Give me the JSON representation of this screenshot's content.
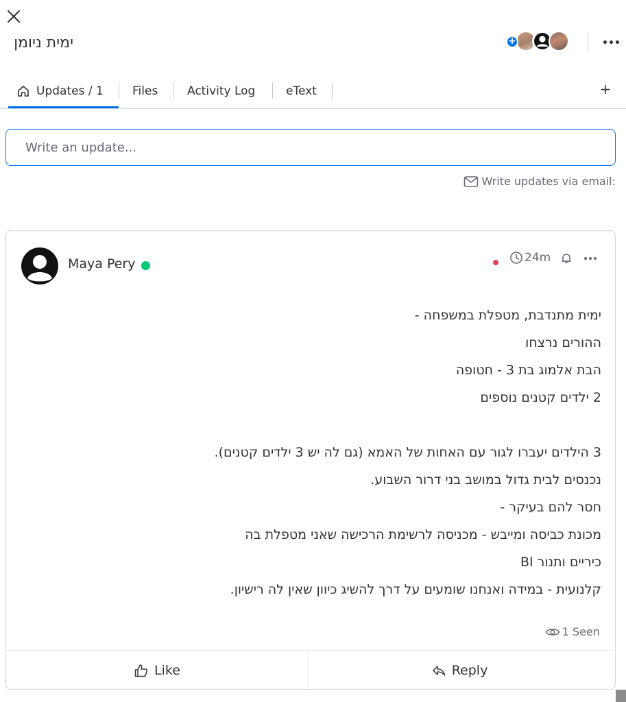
{
  "header": {
    "title": "ימית ניומן",
    "close_icon": "close-icon",
    "subscriber_add_label": "+",
    "more_icon": "more-horizontal-icon"
  },
  "tabs": {
    "items": [
      {
        "label": "Updates / 1",
        "icon": "home-icon",
        "active": true
      },
      {
        "label": "Files"
      },
      {
        "label": "Activity Log"
      },
      {
        "label": "eText"
      }
    ],
    "add_label": "+"
  },
  "composer": {
    "placeholder": "Write an update...",
    "email_link": "Write updates via email:"
  },
  "post": {
    "author": "Maya Pery",
    "time": "24m",
    "lines": [
      "ימית מתנדבת, מטפלת במשפחה -",
      "ההורים נרצחו",
      "הבת אלמוג בת 3 - חטופה",
      "2 ילדים קטנים נוספים",
      "",
      "3 הילדים יעברו לגור עם האחות של האמא (גם לה יש 3 ילדים קטנים).",
      "נכנסים לבית גדול במושב בני דרור השבוע.",
      "חסר להם בעיקר -",
      "מכונת כביסה ומייבש - מכניסה לרשימת הרכישה שאני מטפלת בה",
      "כיריים ותנור BI",
      "קלנועית - במידה ואנחנו שומעים על דרך להשיג כיוון שאין לה רישיון."
    ],
    "seen": "1 Seen",
    "like_label": "Like",
    "reply_label": "Reply"
  },
  "colors": {
    "accent": "#0073ea",
    "online": "#00c875",
    "unread": "#e44258",
    "text": "#323338",
    "muted": "#676879"
  }
}
